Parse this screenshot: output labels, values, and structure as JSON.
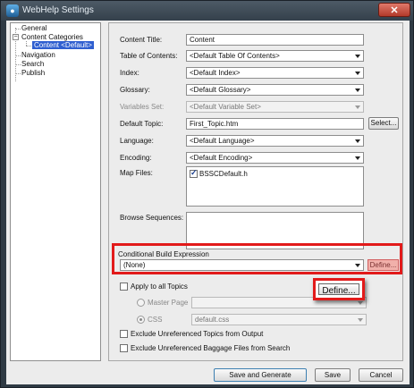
{
  "window": {
    "title": "WebHelp Settings",
    "close_label": "✕"
  },
  "tree": {
    "general": "General",
    "content_categories": "Content Categories",
    "content_default": "Content <Default>",
    "navigation": "Navigation",
    "search": "Search",
    "publish": "Publish",
    "expander_symbol": "−"
  },
  "form": {
    "content_title_label": "Content Title:",
    "content_title_value": "Content",
    "toc_label": "Table of Contents:",
    "toc_value": "<Default Table Of Contents>",
    "index_label": "Index:",
    "index_value": "<Default Index>",
    "glossary_label": "Glossary:",
    "glossary_value": "<Default Glossary>",
    "variable_set_label": "Variables Set:",
    "variable_set_value": "<Default Variable Set>",
    "default_topic_label": "Default Topic:",
    "default_topic_value": "First_Topic.htm",
    "select_button": "Select...",
    "language_label": "Language:",
    "language_value": "<Default Language>",
    "encoding_label": "Encoding:",
    "encoding_value": "<Default Encoding>",
    "map_files_label": "Map Files:",
    "map_file_item": "BSSCDefault.h",
    "browse_sequences_label": "Browse Sequences:",
    "cbe_label": "Conditional Build Expression",
    "cbe_value": "(None)",
    "define_small": "Define...",
    "apply_all_topics": "Apply to all Topics",
    "master_page_label": "Master Page",
    "css_label": "CSS",
    "css_value": "default.css",
    "exclude_topics": "Exclude Unreferenced Topics from Output",
    "exclude_baggage": "Exclude Unreferenced Baggage Files from Search"
  },
  "callout": {
    "define_label": "Define...",
    "accent_color": "#e21a1a"
  },
  "buttons": {
    "save_and_generate": "Save and Generate",
    "save": "Save",
    "cancel": "Cancel"
  },
  "icons": {
    "app": "webhelp-app-icon",
    "close": "close-icon",
    "dropdown": "chevron-down-icon",
    "expander": "tree-collapse-icon"
  }
}
